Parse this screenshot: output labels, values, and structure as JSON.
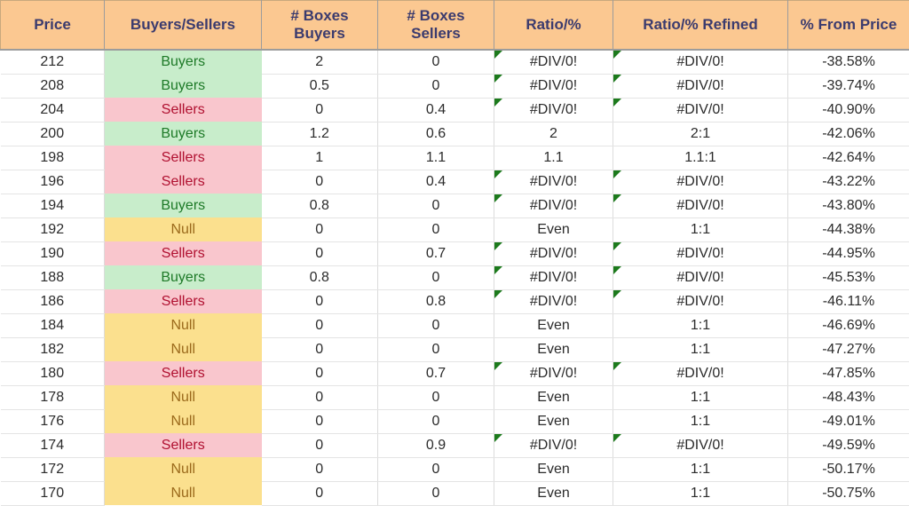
{
  "table": {
    "columns": [
      {
        "key": "price",
        "label": "Price"
      },
      {
        "key": "signal",
        "label": "Buyers/Sellers"
      },
      {
        "key": "boxes_buyers",
        "label": "# Boxes\nBuyers"
      },
      {
        "key": "boxes_sellers",
        "label": "# Boxes\nSellers"
      },
      {
        "key": "ratio",
        "label": "Ratio/%"
      },
      {
        "key": "ratio_refined",
        "label": "Ratio/% Refined"
      },
      {
        "key": "pct_from_price",
        "label": "% From Price"
      }
    ],
    "rows": [
      {
        "price": "212",
        "signal": "Buyers",
        "boxes_buyers": "2",
        "boxes_sellers": "0",
        "ratio": "#DIV/0!",
        "ratio_error": true,
        "ratio_refined": "#DIV/0!",
        "refined_error": true,
        "pct_from_price": "-38.58%"
      },
      {
        "price": "208",
        "signal": "Buyers",
        "boxes_buyers": "0.5",
        "boxes_sellers": "0",
        "ratio": "#DIV/0!",
        "ratio_error": true,
        "ratio_refined": "#DIV/0!",
        "refined_error": true,
        "pct_from_price": "-39.74%"
      },
      {
        "price": "204",
        "signal": "Sellers",
        "boxes_buyers": "0",
        "boxes_sellers": "0.4",
        "ratio": "#DIV/0!",
        "ratio_error": true,
        "ratio_refined": "#DIV/0!",
        "refined_error": true,
        "pct_from_price": "-40.90%"
      },
      {
        "price": "200",
        "signal": "Buyers",
        "boxes_buyers": "1.2",
        "boxes_sellers": "0.6",
        "ratio": "2",
        "ratio_error": false,
        "ratio_refined": "2:1",
        "refined_error": false,
        "pct_from_price": "-42.06%"
      },
      {
        "price": "198",
        "signal": "Sellers",
        "boxes_buyers": "1",
        "boxes_sellers": "1.1",
        "ratio": "1.1",
        "ratio_error": false,
        "ratio_refined": "1.1:1",
        "refined_error": false,
        "pct_from_price": "-42.64%"
      },
      {
        "price": "196",
        "signal": "Sellers",
        "boxes_buyers": "0",
        "boxes_sellers": "0.4",
        "ratio": "#DIV/0!",
        "ratio_error": true,
        "ratio_refined": "#DIV/0!",
        "refined_error": true,
        "pct_from_price": "-43.22%"
      },
      {
        "price": "194",
        "signal": "Buyers",
        "boxes_buyers": "0.8",
        "boxes_sellers": "0",
        "ratio": "#DIV/0!",
        "ratio_error": true,
        "ratio_refined": "#DIV/0!",
        "refined_error": true,
        "pct_from_price": "-43.80%"
      },
      {
        "price": "192",
        "signal": "Null",
        "boxes_buyers": "0",
        "boxes_sellers": "0",
        "ratio": "Even",
        "ratio_error": false,
        "ratio_refined": "1:1",
        "refined_error": false,
        "pct_from_price": "-44.38%"
      },
      {
        "price": "190",
        "signal": "Sellers",
        "boxes_buyers": "0",
        "boxes_sellers": "0.7",
        "ratio": "#DIV/0!",
        "ratio_error": true,
        "ratio_refined": "#DIV/0!",
        "refined_error": true,
        "pct_from_price": "-44.95%"
      },
      {
        "price": "188",
        "signal": "Buyers",
        "boxes_buyers": "0.8",
        "boxes_sellers": "0",
        "ratio": "#DIV/0!",
        "ratio_error": true,
        "ratio_refined": "#DIV/0!",
        "refined_error": true,
        "pct_from_price": "-45.53%"
      },
      {
        "price": "186",
        "signal": "Sellers",
        "boxes_buyers": "0",
        "boxes_sellers": "0.8",
        "ratio": "#DIV/0!",
        "ratio_error": true,
        "ratio_refined": "#DIV/0!",
        "refined_error": true,
        "pct_from_price": "-46.11%"
      },
      {
        "price": "184",
        "signal": "Null",
        "boxes_buyers": "0",
        "boxes_sellers": "0",
        "ratio": "Even",
        "ratio_error": false,
        "ratio_refined": "1:1",
        "refined_error": false,
        "pct_from_price": "-46.69%"
      },
      {
        "price": "182",
        "signal": "Null",
        "boxes_buyers": "0",
        "boxes_sellers": "0",
        "ratio": "Even",
        "ratio_error": false,
        "ratio_refined": "1:1",
        "refined_error": false,
        "pct_from_price": "-47.27%"
      },
      {
        "price": "180",
        "signal": "Sellers",
        "boxes_buyers": "0",
        "boxes_sellers": "0.7",
        "ratio": "#DIV/0!",
        "ratio_error": true,
        "ratio_refined": "#DIV/0!",
        "refined_error": true,
        "pct_from_price": "-47.85%"
      },
      {
        "price": "178",
        "signal": "Null",
        "boxes_buyers": "0",
        "boxes_sellers": "0",
        "ratio": "Even",
        "ratio_error": false,
        "ratio_refined": "1:1",
        "refined_error": false,
        "pct_from_price": "-48.43%"
      },
      {
        "price": "176",
        "signal": "Null",
        "boxes_buyers": "0",
        "boxes_sellers": "0",
        "ratio": "Even",
        "ratio_error": false,
        "ratio_refined": "1:1",
        "refined_error": false,
        "pct_from_price": "-49.01%"
      },
      {
        "price": "174",
        "signal": "Sellers",
        "boxes_buyers": "0",
        "boxes_sellers": "0.9",
        "ratio": "#DIV/0!",
        "ratio_error": true,
        "ratio_refined": "#DIV/0!",
        "refined_error": true,
        "pct_from_price": "-49.59%"
      },
      {
        "price": "172",
        "signal": "Null",
        "boxes_buyers": "0",
        "boxes_sellers": "0",
        "ratio": "Even",
        "ratio_error": false,
        "ratio_refined": "1:1",
        "refined_error": false,
        "pct_from_price": "-50.17%"
      },
      {
        "price": "170",
        "signal": "Null",
        "boxes_buyers": "0",
        "boxes_sellers": "0",
        "ratio": "Even",
        "ratio_error": false,
        "ratio_refined": "1:1",
        "refined_error": false,
        "pct_from_price": "-50.75%"
      }
    ]
  },
  "colors": {
    "header_bg": "#FBC891",
    "header_text": "#3B3B6E",
    "buyers_bg": "#C8EDCB",
    "buyers_text": "#1E7A28",
    "sellers_bg": "#F9C6CD",
    "sellers_text": "#B01030",
    "null_bg": "#FBE08E",
    "null_text": "#9B6A1C",
    "error_flag": "#1C7A1C",
    "grid_line": "#DCDCDC"
  }
}
